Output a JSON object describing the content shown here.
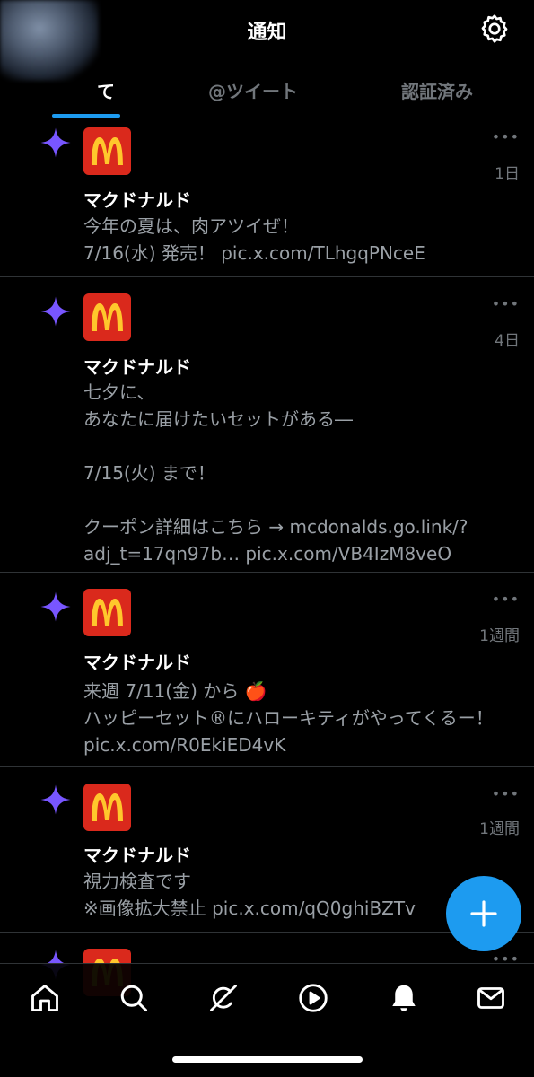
{
  "header": {
    "title": "通知"
  },
  "tabs": [
    {
      "label": "て"
    },
    {
      "label": "@ツイート"
    },
    {
      "label": "認証済み"
    }
  ],
  "notifications": [
    {
      "name": "マクドナルド",
      "time": "1日",
      "more": "•••",
      "body": "今年の夏は、肉アツイぜ！\n7/16(水) 発売！ pic.x.com/TLhgqPNceE"
    },
    {
      "name": "マクドナルド",
      "time": "4日",
      "more": "•••",
      "body": "七夕に、\nあなたに届けたいセットがある―\n\n7/15(火) まで！\n\nクーポン詳細はこちら → mcdonalds.go.link/?\nadj_t=17qn97b… pic.x.com/VB4IzM8veO"
    },
    {
      "name": "マクドナルド",
      "time": "1週間",
      "more": "•••",
      "body": "来週 7/11(金) から 🍎\nハッピーセット®にハローキティがやってくるー！\npic.x.com/R0EkiED4vK"
    },
    {
      "name": "マクドナルド",
      "time": "1週間",
      "more": "•••",
      "body": "視力検査です\n※画像拡大禁止 pic.x.com/qQ0ghiBZTv"
    },
    {
      "name": "",
      "time": "",
      "more": "•••",
      "body": ""
    }
  ],
  "icons": {
    "sparkle_color": "#7856ff",
    "accent": "#1d9bf0",
    "brand_red": "#da291c",
    "brand_yellow": "#ffc72c"
  },
  "bottom_nav": [
    "home-icon",
    "search-icon",
    "grok-icon",
    "video-icon",
    "notifications-icon",
    "messages-icon"
  ]
}
